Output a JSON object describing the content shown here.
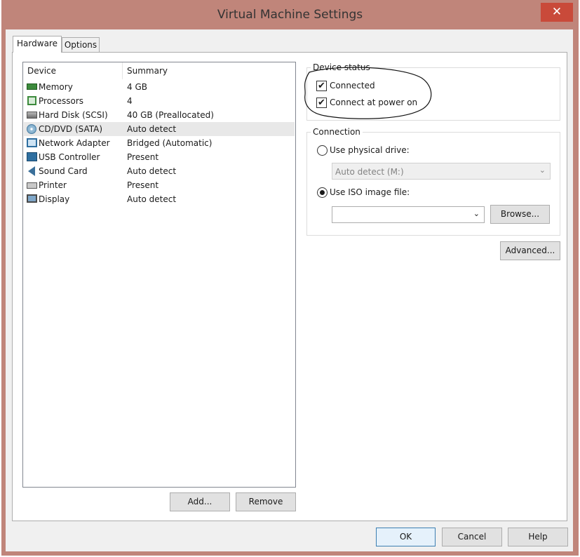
{
  "window": {
    "title": "Virtual Machine Settings",
    "close_glyph": "✕"
  },
  "tabs": [
    {
      "label": "Hardware",
      "selected": true
    },
    {
      "label": "Options",
      "selected": false
    }
  ],
  "device_list": {
    "headers": {
      "device": "Device",
      "summary": "Summary"
    },
    "rows": [
      {
        "device": "Memory",
        "summary": "4 GB",
        "icon": "memory-icon"
      },
      {
        "device": "Processors",
        "summary": "4",
        "icon": "processor-icon"
      },
      {
        "device": "Hard Disk (SCSI)",
        "summary": "40 GB (Preallocated)",
        "icon": "hard-disk-icon"
      },
      {
        "device": "CD/DVD (SATA)",
        "summary": "Auto detect",
        "icon": "cd-dvd-icon",
        "selected": true
      },
      {
        "device": "Network Adapter",
        "summary": "Bridged (Automatic)",
        "icon": "network-adapter-icon"
      },
      {
        "device": "USB Controller",
        "summary": "Present",
        "icon": "usb-icon"
      },
      {
        "device": "Sound Card",
        "summary": "Auto detect",
        "icon": "sound-card-icon"
      },
      {
        "device": "Printer",
        "summary": "Present",
        "icon": "printer-icon"
      },
      {
        "device": "Display",
        "summary": "Auto detect",
        "icon": "display-icon"
      }
    ]
  },
  "list_buttons": {
    "add": "Add...",
    "remove": "Remove"
  },
  "device_status": {
    "title": "Device status",
    "connected": {
      "label": "Connected",
      "checked": true
    },
    "connect_at_power_on": {
      "label": "Connect at power on",
      "checked": true
    }
  },
  "connection": {
    "title": "Connection",
    "physical_drive": {
      "label": "Use physical drive:",
      "selected": false,
      "value": "Auto detect (M:)"
    },
    "iso_image": {
      "label": "Use ISO image file:",
      "selected": true,
      "value": ""
    },
    "browse": "Browse..."
  },
  "advanced_button": "Advanced...",
  "footer": {
    "ok": "OK",
    "cancel": "Cancel",
    "help": "Help"
  },
  "colors": {
    "frame": "#c0857a",
    "close": "#c94a3a",
    "selection": "#e8e8e8",
    "ink": "#1a1a1a"
  },
  "check_glyph": "✔",
  "arrow_glyph": "⌄"
}
